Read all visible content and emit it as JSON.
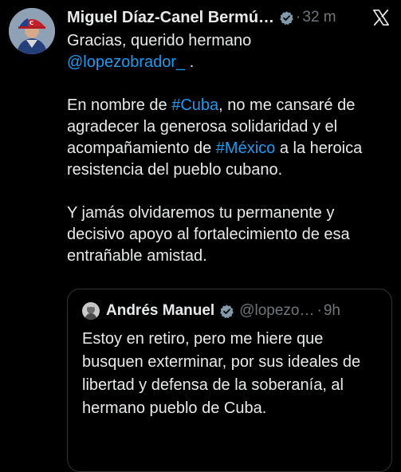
{
  "tweet": {
    "author_name": "Miguel Díaz-Canel Bermú…",
    "separator": "·",
    "time": "32 m",
    "greeting": "Gracias, querido hermano",
    "mention": "@lopezobrador_",
    "mention_suffix": " .",
    "p2_before": "En nombre de ",
    "p2_hashtag1": "#Cuba",
    "p2_middle": ", no me cansaré de agradecer la generosa solidaridad y el acompañamiento de ",
    "p2_hashtag2": "#México",
    "p2_after": " a la heroica resistencia del pueblo cubano.",
    "p3": "Y jamás olvidaremos tu permanente y decisivo apoyo al fortalecimiento de esa entrañable amistad."
  },
  "quoted_tweet": {
    "author_name": "Andrés Manuel",
    "handle": "@lopezo…",
    "separator": "·",
    "time": "9h",
    "text": "Estoy en retiro, pero me hiere que busquen exterminar, por sus ideales de libertad y defensa de la soberanía, al hermano pueblo de Cuba."
  },
  "icons": {
    "verified": "verified-badge-icon",
    "platform": "x-logo-icon"
  },
  "colors": {
    "background": "#000000",
    "text": "#e7e9ea",
    "muted": "#71767b",
    "link": "#1d9bf0",
    "border": "#2f3336"
  }
}
